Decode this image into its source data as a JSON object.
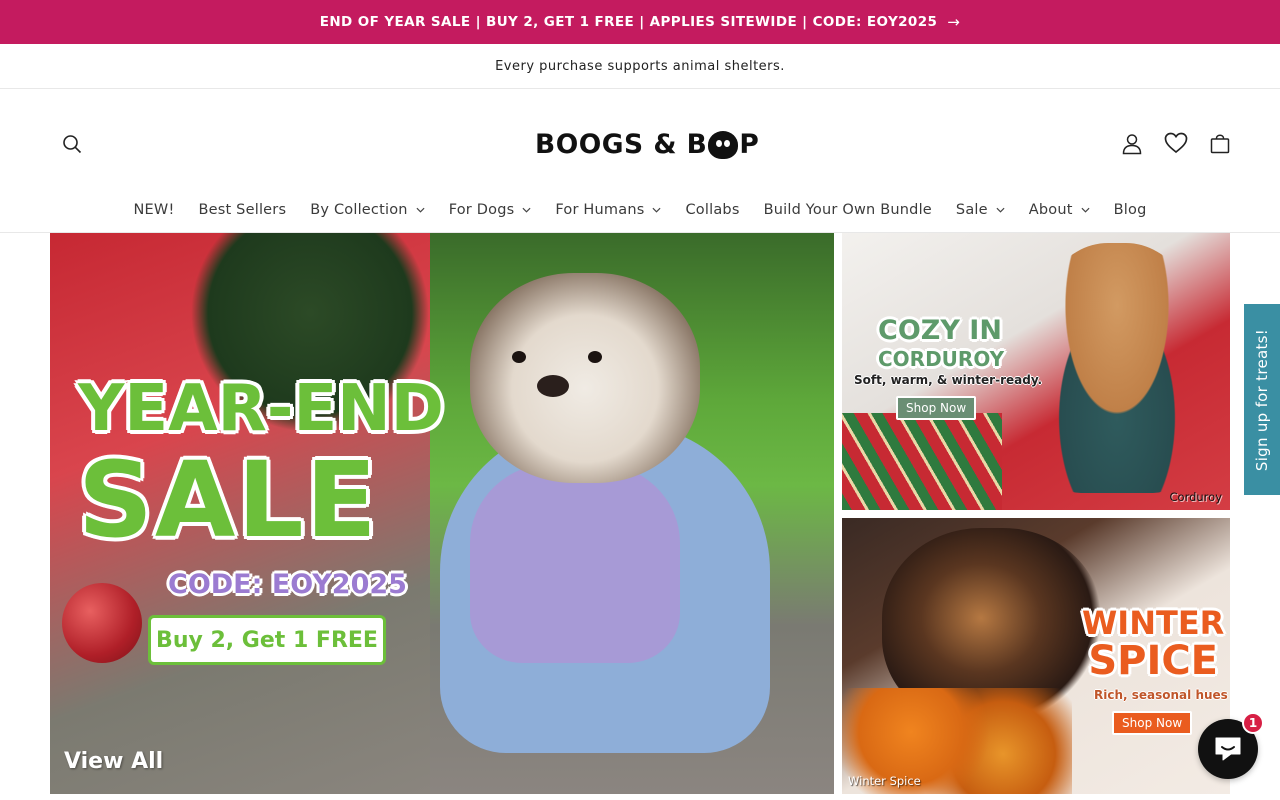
{
  "announcement": {
    "text": "END OF YEAR SALE | BUY 2, GET 1 FREE | APPLIES SITEWIDE | CODE: EOY2025",
    "arrow_icon": "arrow-right-icon",
    "bg_color": "#c41b5f"
  },
  "sub_announcement": {
    "text": "Every purchase supports animal shelters."
  },
  "header": {
    "logo_text_left": "BOOGS & B",
    "logo_text_right": "P",
    "icons": [
      "search-icon",
      "account-icon",
      "wishlist-heart-icon",
      "cart-icon"
    ]
  },
  "nav": {
    "items": [
      {
        "label": "NEW!",
        "dropdown": false
      },
      {
        "label": "Best Sellers",
        "dropdown": false
      },
      {
        "label": "By Collection",
        "dropdown": true
      },
      {
        "label": "For Dogs",
        "dropdown": true
      },
      {
        "label": "For Humans",
        "dropdown": true
      },
      {
        "label": "Collabs",
        "dropdown": false
      },
      {
        "label": "Build Your Own Bundle",
        "dropdown": false
      },
      {
        "label": "Sale",
        "dropdown": true
      },
      {
        "label": "About",
        "dropdown": true
      },
      {
        "label": "Blog",
        "dropdown": false
      }
    ]
  },
  "hero": {
    "title_line1": "YEAR-END",
    "title_line2": "SALE",
    "code": "CODE: EOY2025",
    "offer": "Buy 2, Get 1 FREE",
    "view_all": "View All",
    "accent_color": "#6cbf3a"
  },
  "tiles": [
    {
      "title_line1": "COZY IN",
      "title_line2": "CORDUROY",
      "subtitle": "Soft, warm, & winter-ready.",
      "button": "Shop Now",
      "caption": "Corduroy"
    },
    {
      "title_line1": "WINTER",
      "title_line2": "SPICE",
      "subtitle": "Rich, seasonal hues",
      "button": "Shop Now",
      "caption": "Winter Spice"
    }
  ],
  "signup_tab": {
    "label": "Sign up for treats!",
    "color": "#3a8fa3"
  },
  "chat": {
    "icon": "chat-bubble-icon",
    "badge_count": "1"
  }
}
